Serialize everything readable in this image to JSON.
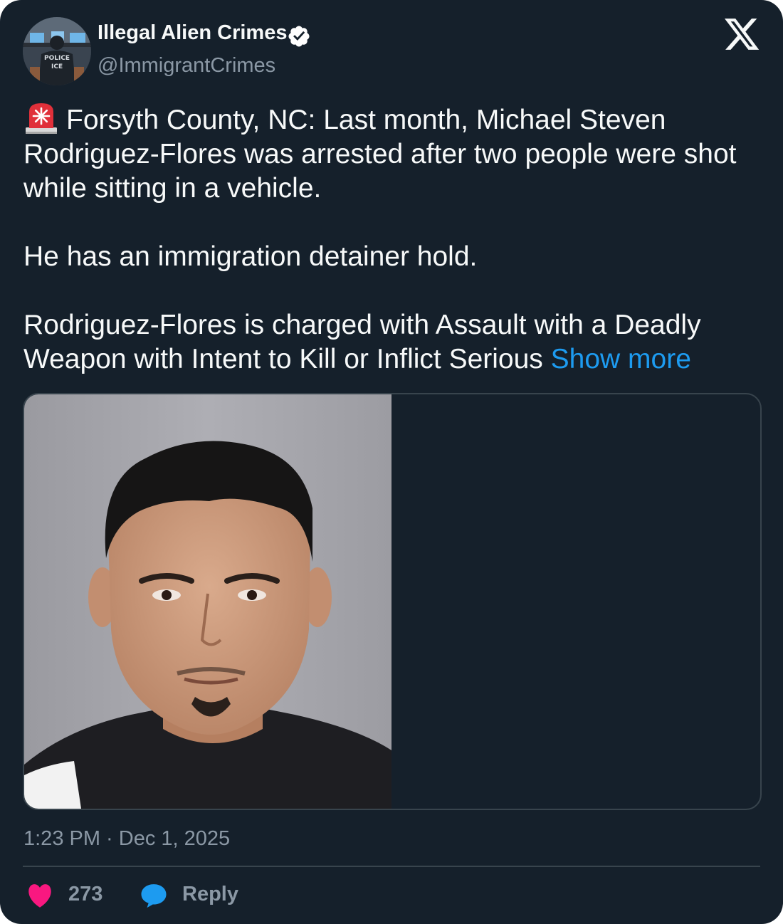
{
  "author": {
    "display_name": "Illegal Alien Crimes",
    "handle": "@ImmigrantCrimes",
    "verified": true,
    "avatar_icon": "police-ice-officer-avatar",
    "avatar_text_line1": "POLICE",
    "avatar_text_line2": "ICE"
  },
  "platform_icon": "x-logo-icon",
  "tweet": {
    "emoji_icon": "police-siren-emoji",
    "paragraph1": "Forsyth County, NC: Last month, Michael Steven Rodriguez-Flores was arrested after two people were shot while sitting in a vehicle.",
    "paragraph2": "He has an immigration detainer hold.",
    "paragraph3": "Rodriguez-Flores is charged with Assault with a Deadly Weapon with Intent to Kill or Inflict Serious",
    "show_more": "Show more"
  },
  "media": {
    "photo_icon": "mugshot-photo"
  },
  "timestamp": "1:23 PM · Dec 1, 2025",
  "actions": {
    "like_count": "273",
    "reply_label": "Reply"
  },
  "colors": {
    "background": "#15202b",
    "text": "#f7f9f9",
    "secondary_text": "#8b98a5",
    "link": "#1d9bf0",
    "like": "#f91880",
    "verified": "#ffffff"
  }
}
